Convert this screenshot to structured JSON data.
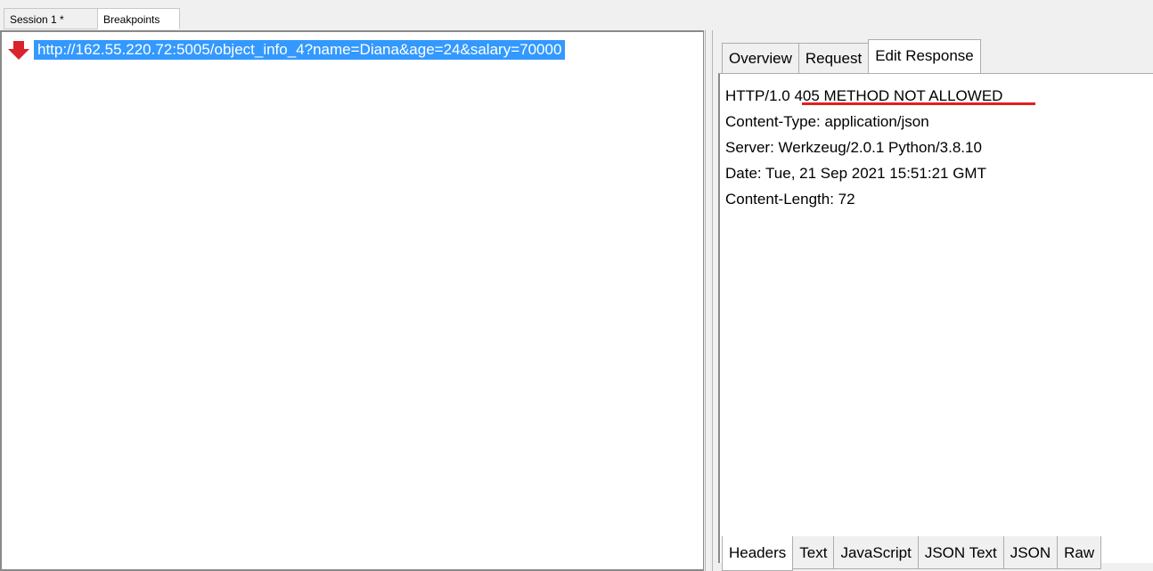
{
  "top_tabs": [
    {
      "label": "Session 1 *"
    },
    {
      "label": "Breakpoints"
    }
  ],
  "breakpoints": {
    "icon": "red-down-arrow-icon",
    "url": "http://162.55.220.72:5005/object_info_4?name=Diana&age=24&salary=70000"
  },
  "inspector": {
    "tabs": [
      {
        "label": "Overview"
      },
      {
        "label": "Request"
      },
      {
        "label": "Edit Response"
      }
    ],
    "response_lines": [
      "HTTP/1.0 405 METHOD NOT ALLOWED",
      "Content-Type: application/json",
      "Server: Werkzeug/2.0.1 Python/3.8.10",
      "Date: Tue, 21 Sep 2021 15:51:21 GMT",
      "Content-Length: 72"
    ],
    "bottom_tabs": [
      {
        "label": "Headers"
      },
      {
        "label": "Text"
      },
      {
        "label": "JavaScript"
      },
      {
        "label": "JSON Text"
      },
      {
        "label": "JSON"
      },
      {
        "label": "Raw"
      }
    ]
  },
  "colors": {
    "selection": "#3399ff",
    "underline": "#e0201e",
    "arrow": "#d9232d"
  }
}
